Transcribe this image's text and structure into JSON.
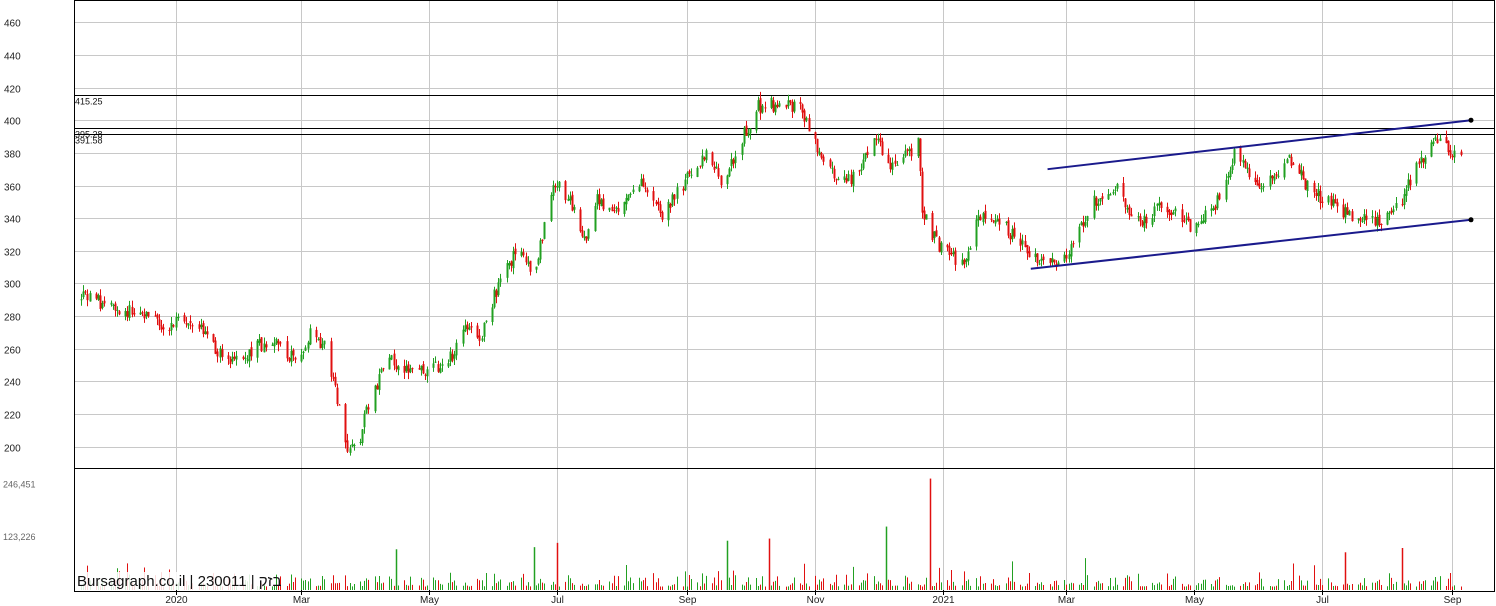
{
  "chart_data": {
    "type": "candlestick",
    "watermark": "Bursagraph.co.il | 230011 | בזק",
    "colors": {
      "up": "#22a022",
      "down": "#e01010",
      "trendline": "#1a1a8c",
      "grid": "#c8c8c8",
      "hline": "#000000"
    },
    "y_axis": {
      "ylim": [
        187,
        473
      ],
      "ticks": [
        200,
        220,
        240,
        260,
        280,
        300,
        320,
        340,
        360,
        380,
        400,
        420,
        440,
        460
      ]
    },
    "volume_axis": {
      "max": 280000,
      "ticks": [
        "246,451",
        "123,226"
      ],
      "tick_values": [
        246451,
        123226
      ]
    },
    "x_axis": {
      "start": "2019-11-15",
      "end": "2021-09-10",
      "ticks": [
        {
          "label": "2020",
          "date": "2020-01-01"
        },
        {
          "label": "Mar",
          "date": "2020-03-01"
        },
        {
          "label": "May",
          "date": "2020-05-01"
        },
        {
          "label": "Jul",
          "date": "2020-07-01"
        },
        {
          "label": "Sep",
          "date": "2020-09-01"
        },
        {
          "label": "Nov",
          "date": "2020-11-01"
        },
        {
          "label": "2021",
          "date": "2021-01-01"
        },
        {
          "label": "Mar",
          "date": "2021-03-01"
        },
        {
          "label": "May",
          "date": "2021-05-01"
        },
        {
          "label": "Jul",
          "date": "2021-07-01"
        },
        {
          "label": "Sep",
          "date": "2021-09-01"
        }
      ]
    },
    "horizontal_levels": [
      {
        "value": 415.25,
        "label": "415.25"
      },
      {
        "value": 395.28,
        "label": "395.28"
      },
      {
        "value": 391.58,
        "label": "391.58"
      }
    ],
    "trendlines": [
      {
        "from": {
          "date": "2021-02-20",
          "value": 370
        },
        "to": {
          "date": "2021-09-10",
          "value": 400
        }
      },
      {
        "from": {
          "date": "2021-02-12",
          "value": 309
        },
        "to": {
          "date": "2021-09-10",
          "value": 339
        }
      }
    ],
    "close_path": [
      [
        "2019-11-15",
        290
      ],
      [
        "2019-11-20",
        292
      ],
      [
        "2019-12-01",
        286
      ],
      [
        "2019-12-10",
        283
      ],
      [
        "2019-12-25",
        274
      ],
      [
        "2020-01-10",
        278
      ],
      [
        "2020-01-20",
        260
      ],
      [
        "2020-01-30",
        253
      ],
      [
        "2020-02-10",
        262
      ],
      [
        "2020-02-18",
        268
      ],
      [
        "2020-02-22",
        258
      ],
      [
        "2020-02-28",
        252
      ],
      [
        "2020-03-05",
        270
      ],
      [
        "2020-03-12",
        262
      ],
      [
        "2020-03-17",
        235
      ],
      [
        "2020-03-22",
        202
      ],
      [
        "2020-03-27",
        196
      ],
      [
        "2020-04-03",
        232
      ],
      [
        "2020-04-12",
        253
      ],
      [
        "2020-04-22",
        246
      ],
      [
        "2020-05-05",
        248
      ],
      [
        "2020-05-12",
        256
      ],
      [
        "2020-05-20",
        275
      ],
      [
        "2020-05-26",
        268
      ],
      [
        "2020-06-03",
        300
      ],
      [
        "2020-06-12",
        320
      ],
      [
        "2020-06-20",
        305
      ],
      [
        "2020-06-30",
        362
      ],
      [
        "2020-07-07",
        352
      ],
      [
        "2020-07-14",
        325
      ],
      [
        "2020-07-20",
        352
      ],
      [
        "2020-07-30",
        343
      ],
      [
        "2020-08-10",
        360
      ],
      [
        "2020-08-20",
        342
      ],
      [
        "2020-09-01",
        365
      ],
      [
        "2020-09-10",
        380
      ],
      [
        "2020-09-18",
        360
      ],
      [
        "2020-09-28",
        392
      ],
      [
        "2020-10-05",
        408
      ],
      [
        "2020-10-15",
        410
      ],
      [
        "2020-10-25",
        408
      ],
      [
        "2020-11-05",
        375
      ],
      [
        "2020-11-15",
        362
      ],
      [
        "2020-11-22",
        368
      ],
      [
        "2020-11-30",
        388
      ],
      [
        "2020-12-08",
        370
      ],
      [
        "2020-12-20",
        386
      ],
      [
        "2020-12-22",
        345
      ],
      [
        "2020-12-30",
        322
      ],
      [
        "2021-01-10",
        312
      ],
      [
        "2021-01-20",
        345
      ],
      [
        "2021-01-30",
        335
      ],
      [
        "2021-02-10",
        320
      ],
      [
        "2021-02-20",
        312
      ],
      [
        "2021-03-02",
        318
      ],
      [
        "2021-03-12",
        348
      ],
      [
        "2021-03-25",
        360
      ],
      [
        "2021-04-05",
        335
      ],
      [
        "2021-04-15",
        350
      ],
      [
        "2021-04-28",
        335
      ],
      [
        "2021-05-10",
        345
      ],
      [
        "2021-05-20",
        378
      ],
      [
        "2021-05-28",
        365
      ],
      [
        "2021-06-05",
        360
      ],
      [
        "2021-06-14",
        378
      ],
      [
        "2021-06-25",
        358
      ],
      [
        "2021-07-05",
        348
      ],
      [
        "2021-07-20",
        340
      ],
      [
        "2021-07-30",
        336
      ],
      [
        "2021-08-05",
        345
      ],
      [
        "2021-08-15",
        370
      ],
      [
        "2021-08-25",
        388
      ],
      [
        "2021-09-05",
        378
      ]
    ],
    "volume_spikes": [
      {
        "date": "2020-12-26",
        "value": 260000
      },
      {
        "date": "2020-12-05",
        "value": 148000
      },
      {
        "date": "2020-10-10",
        "value": 120000
      },
      {
        "date": "2020-09-20",
        "value": 115000
      },
      {
        "date": "2020-07-01",
        "value": 110000
      },
      {
        "date": "2020-06-20",
        "value": 100000
      },
      {
        "date": "2021-08-08",
        "value": 98000
      },
      {
        "date": "2020-04-15",
        "value": 95000
      },
      {
        "date": "2021-07-12",
        "value": 88000
      }
    ]
  }
}
